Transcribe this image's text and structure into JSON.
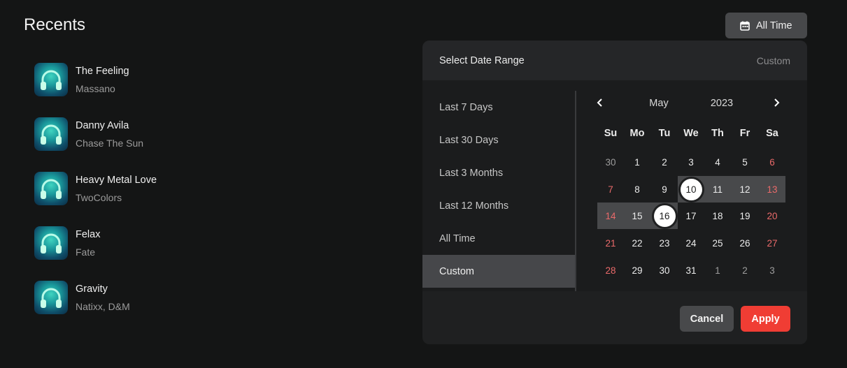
{
  "recents": {
    "title": "Recents",
    "items": [
      {
        "title": "The Feeling",
        "artist": "Massano",
        "cover_icon": "headphones-icon"
      },
      {
        "title": "Danny Avila",
        "artist": "Chase The Sun",
        "cover_icon": "headphones-icon"
      },
      {
        "title": "Heavy Metal Love",
        "artist": "TwoColors",
        "cover_icon": "headphones-icon"
      },
      {
        "title": "Felax",
        "artist": "Fate",
        "cover_icon": "headphones-icon"
      },
      {
        "title": "Gravity",
        "artist": "Natixx, D&M",
        "cover_icon": "headphones-icon"
      }
    ]
  },
  "filter_button": {
    "label": "All Time",
    "icon": "calendar-icon"
  },
  "date_picker": {
    "header_title": "Select Date Range",
    "header_mode": "Custom",
    "presets": [
      "Last 7 Days",
      "Last 30 Days",
      "Last 3 Months",
      "Last 12 Months",
      "All Time",
      "Custom"
    ],
    "active_preset": "Custom",
    "month": "May",
    "year": "2023",
    "weekdays": [
      "Su",
      "Mo",
      "Tu",
      "We",
      "Th",
      "Fr",
      "Sa"
    ],
    "weeks": [
      [
        "30",
        "1",
        "2",
        "3",
        "4",
        "5",
        "6"
      ],
      [
        "7",
        "8",
        "9",
        "10",
        "11",
        "12",
        "13"
      ],
      [
        "14",
        "15",
        "16",
        "17",
        "18",
        "19",
        "20"
      ],
      [
        "21",
        "22",
        "23",
        "24",
        "25",
        "26",
        "27"
      ],
      [
        "28",
        "29",
        "30",
        "31",
        "1",
        "2",
        "3"
      ]
    ],
    "range_start": "10",
    "range_end": "16",
    "cancel_label": "Cancel",
    "apply_label": "Apply"
  },
  "colors": {
    "background": "#141515",
    "accent": "#f03d34",
    "weekend": "#ea6a6a",
    "range_band": "#48494b"
  }
}
